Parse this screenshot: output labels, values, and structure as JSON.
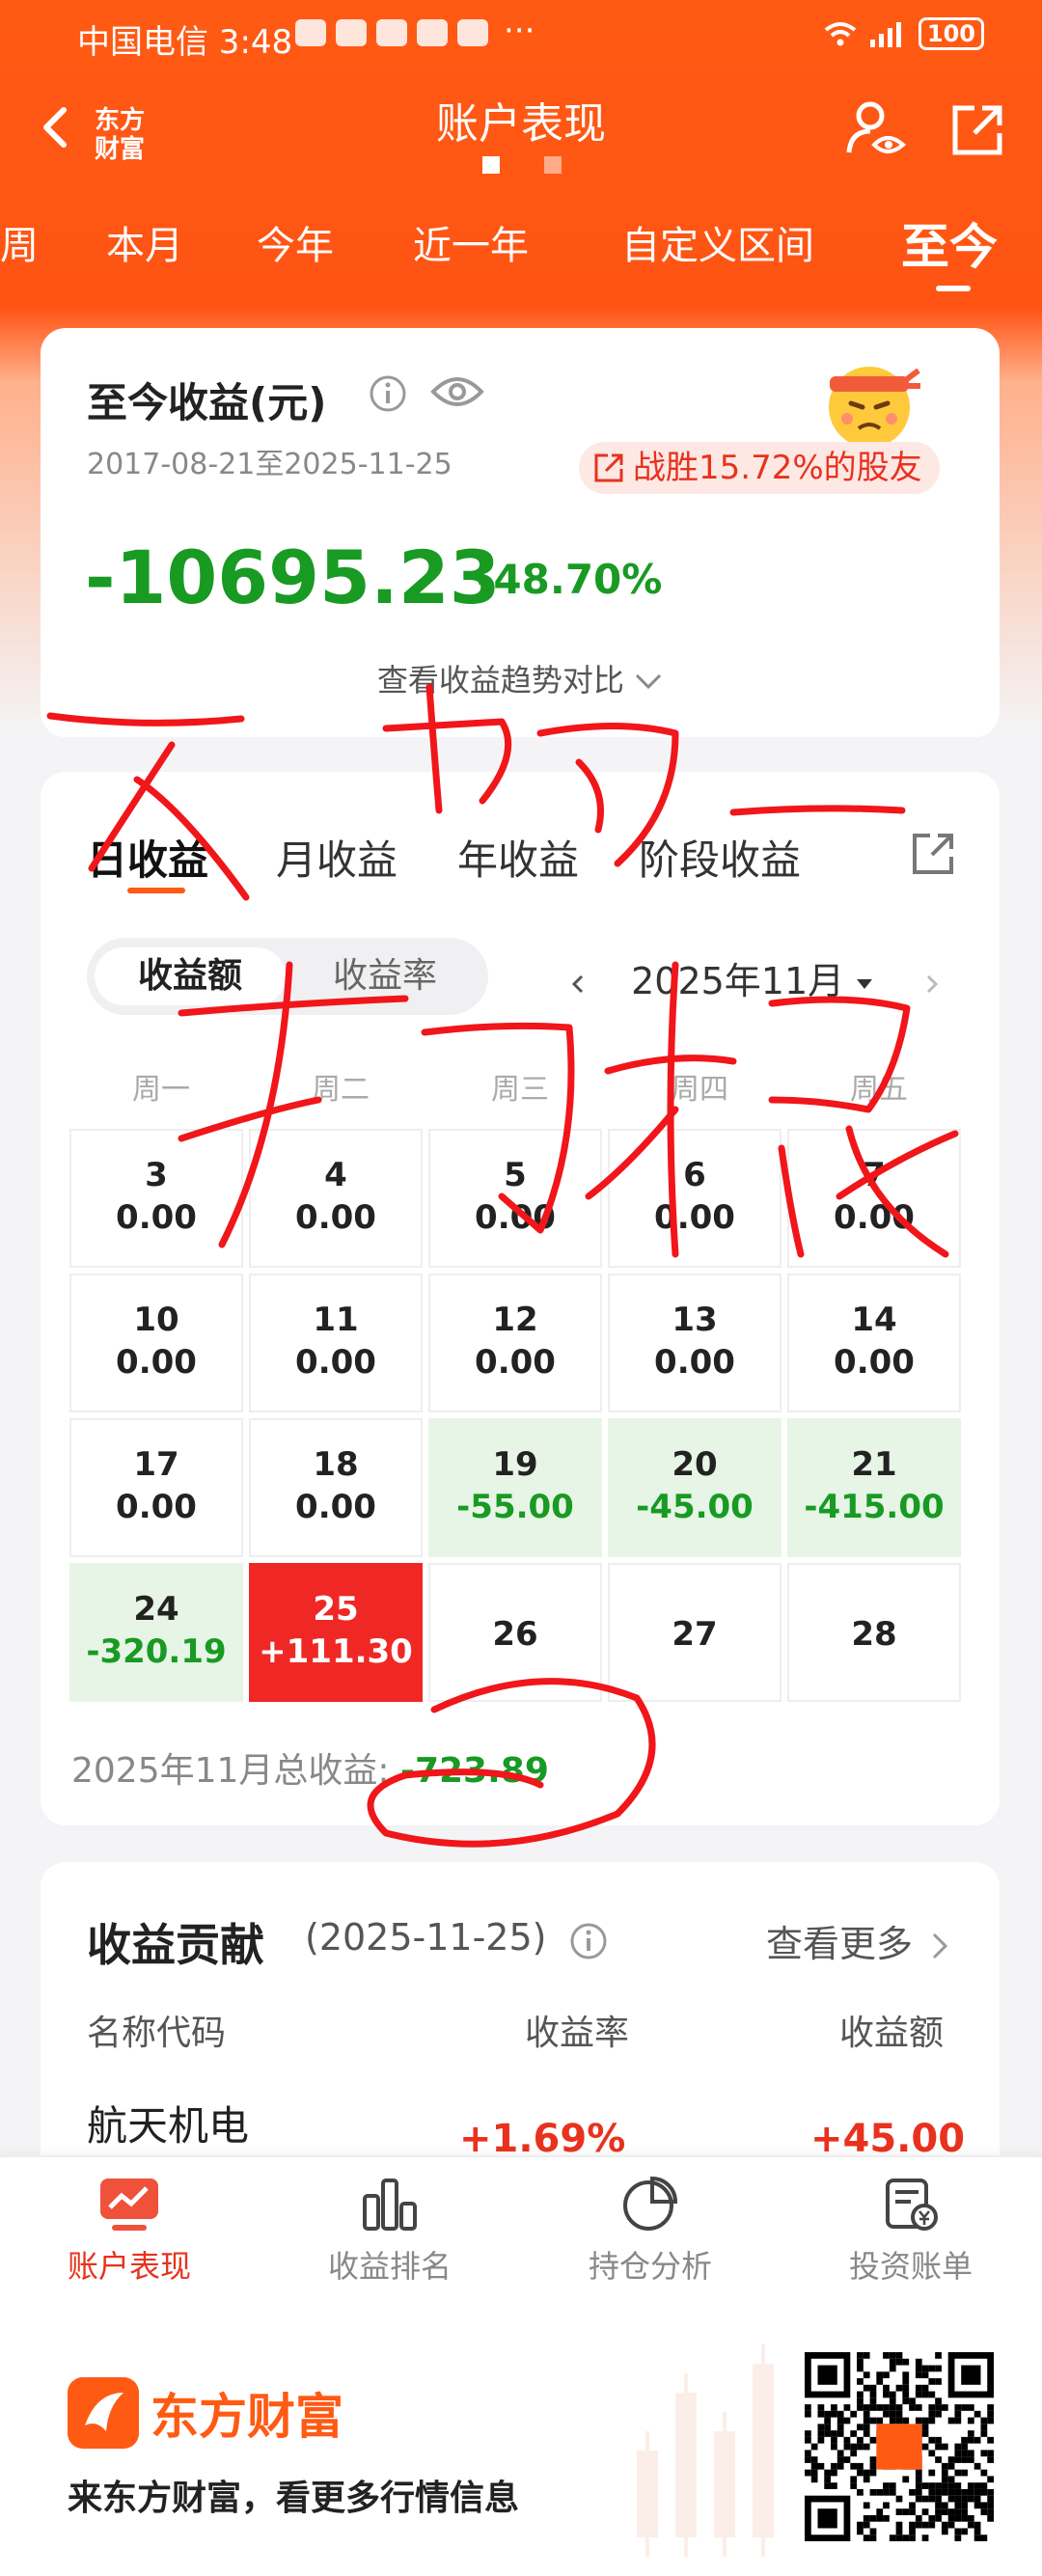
{
  "status_bar": {
    "carrier_time": "中国电信 3:48",
    "more": "···",
    "battery": "100"
  },
  "nav": {
    "brand": "东方财富",
    "title": "账户表现"
  },
  "period_tabs": [
    "周",
    "本月",
    "今年",
    "近一年",
    "自定义区间",
    "至今"
  ],
  "active_period": "至今",
  "summary": {
    "title": "至今收益(元)",
    "date_range": "2017-08-21至2025-11-25",
    "beat_text": "战胜15.72%的股友",
    "total_profit": "-10695.23",
    "total_rate": "-48.70%",
    "trend_link": "查看收益趋势对比"
  },
  "daily": {
    "tabs": [
      "日收益",
      "月收益",
      "年收益",
      "阶段收益"
    ],
    "toggle": [
      "收益额",
      "收益率"
    ],
    "month": "2025年11月",
    "weekdays": [
      "周一",
      "周二",
      "周三",
      "周四",
      "周五"
    ],
    "days": [
      {
        "d": "3",
        "v": "0.00",
        "state": "none"
      },
      {
        "d": "4",
        "v": "0.00",
        "state": "none"
      },
      {
        "d": "5",
        "v": "0.00",
        "state": "none"
      },
      {
        "d": "6",
        "v": "0.00",
        "state": "none"
      },
      {
        "d": "7",
        "v": "0.00",
        "state": "none"
      },
      {
        "d": "10",
        "v": "0.00",
        "state": "none"
      },
      {
        "d": "11",
        "v": "0.00",
        "state": "none"
      },
      {
        "d": "12",
        "v": "0.00",
        "state": "none"
      },
      {
        "d": "13",
        "v": "0.00",
        "state": "none"
      },
      {
        "d": "14",
        "v": "0.00",
        "state": "none"
      },
      {
        "d": "17",
        "v": "0.00",
        "state": "none"
      },
      {
        "d": "18",
        "v": "0.00",
        "state": "none"
      },
      {
        "d": "19",
        "v": "-55.00",
        "state": "loss"
      },
      {
        "d": "20",
        "v": "-45.00",
        "state": "loss"
      },
      {
        "d": "21",
        "v": "-415.00",
        "state": "loss"
      },
      {
        "d": "24",
        "v": "-320.19",
        "state": "loss"
      },
      {
        "d": "25",
        "v": "+111.30",
        "state": "selected"
      },
      {
        "d": "26",
        "v": "",
        "state": "future"
      },
      {
        "d": "27",
        "v": "",
        "state": "future"
      },
      {
        "d": "28",
        "v": "",
        "state": "future"
      }
    ],
    "month_total_label": "2025年11月总收益:",
    "month_total_value": "-723.89"
  },
  "contribution": {
    "title": "收益贡献",
    "date": "(2025-11-25)",
    "see_more": "查看更多",
    "headers": [
      "名称代码",
      "收益率",
      "收益额"
    ],
    "row": {
      "name": "航天机电",
      "rate": "+1.69%",
      "amount": "+45.00"
    }
  },
  "bottom_nav": [
    "账户表现",
    "收益排名",
    "持仓分析",
    "投资账单"
  ],
  "footer": {
    "brand": "东方财富",
    "slogan": "来东方财富，看更多行情信息"
  },
  "colors": {
    "brand_orange": "#ff5a14",
    "loss_green": "#189a23",
    "gain_red": "#e8321e"
  }
}
